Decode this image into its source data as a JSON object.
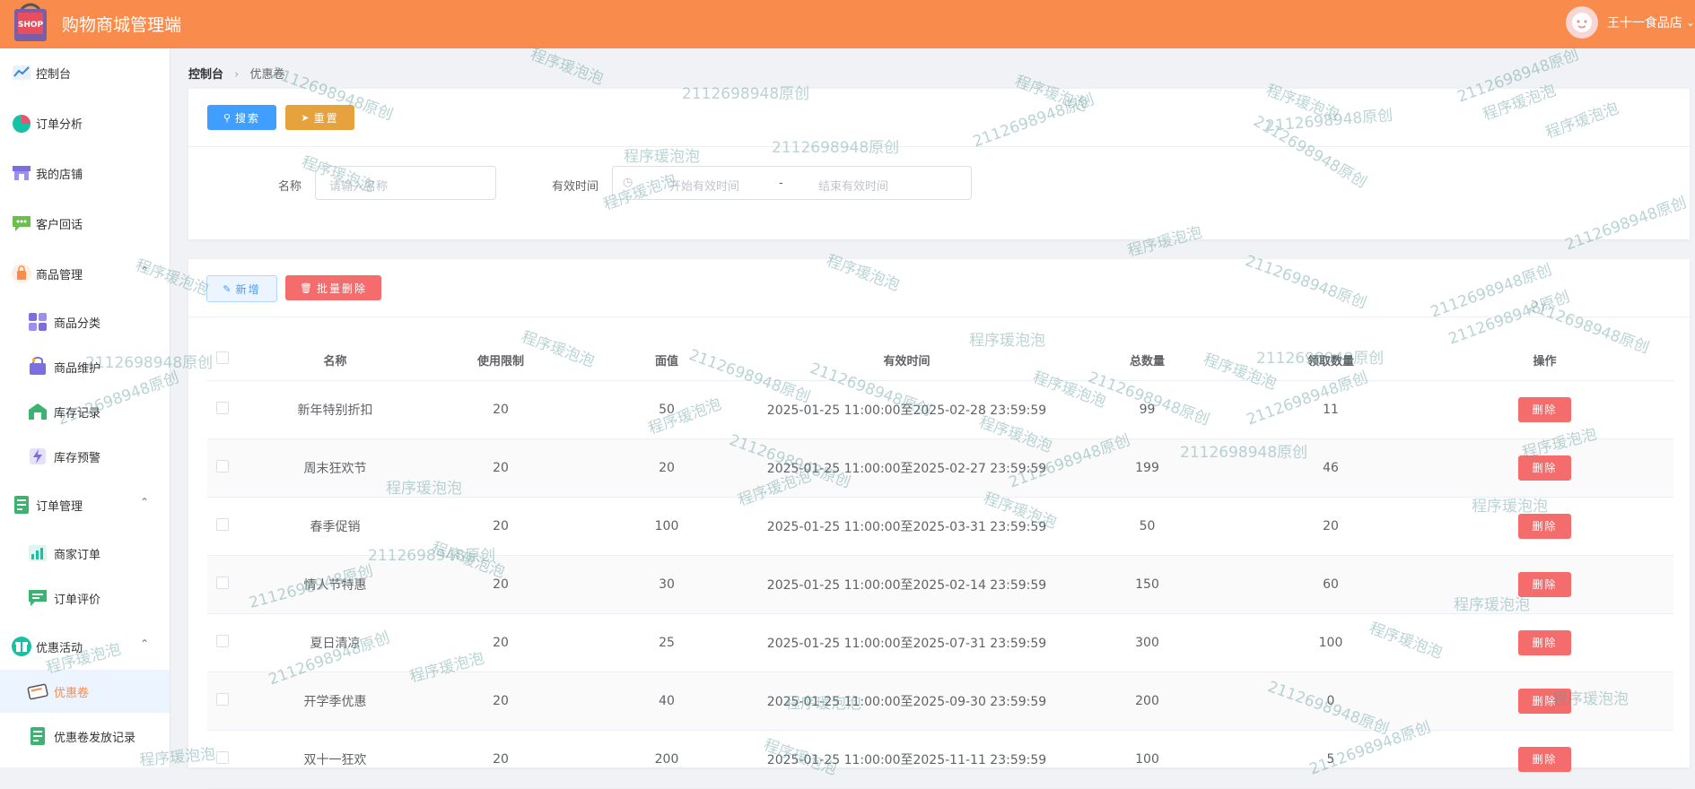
{
  "header": {
    "logo_text": "SHOP",
    "title": "购物商城管理端",
    "user_name": "王十一食品店",
    "colors": {
      "header_bg": "#f98c4d",
      "primary": "#409eff",
      "warning": "#e6a23c",
      "danger": "#f56c6c"
    }
  },
  "sidebar": {
    "items": [
      {
        "label": "控制台",
        "icon": "line-chart-icon"
      },
      {
        "label": "订单分析",
        "icon": "pie-chart-icon"
      },
      {
        "label": "我的店铺",
        "icon": "store-icon"
      },
      {
        "label": "客户回话",
        "icon": "chat-bubble-icon"
      },
      {
        "label": "商品管理",
        "icon": "bag-icon"
      },
      {
        "label": "商品分类",
        "icon": "category-grid-icon"
      },
      {
        "label": "商品维护",
        "icon": "basket-icon"
      },
      {
        "label": "库存记录",
        "icon": "warehouse-icon"
      },
      {
        "label": "库存预警",
        "icon": "lightning-icon"
      },
      {
        "label": "订单管理",
        "icon": "order-list-icon"
      },
      {
        "label": "商家订单",
        "icon": "bar-chart-icon"
      },
      {
        "label": "订单评价",
        "icon": "comment-icon"
      },
      {
        "label": "优惠活动",
        "icon": "gift-icon"
      },
      {
        "label": "优惠卷",
        "icon": "ticket-icon"
      },
      {
        "label": "优惠卷发放记录",
        "icon": "record-list-icon"
      }
    ]
  },
  "breadcrumb": {
    "home": "控制台",
    "current": "优惠卷"
  },
  "search": {
    "search_label": "搜索",
    "reset_label": "重置",
    "name_label": "名称",
    "name_placeholder": "请输入名称",
    "time_label": "有效时间",
    "start_placeholder": "开始有效时间",
    "range_sep": "-",
    "end_placeholder": "结束有效时间"
  },
  "toolbar": {
    "add_label": "新增",
    "batch_delete_label": "批量删除"
  },
  "table": {
    "headers": [
      "名称",
      "使用限制",
      "面值",
      "有效时间",
      "总数量",
      "领取数量",
      "操作"
    ],
    "delete_label": "删除",
    "rows": [
      {
        "name": "新年特别折扣",
        "limit": "20",
        "value": "50",
        "time": "2025-01-25 11:00:00至2025-02-28 23:59:59",
        "total": "99",
        "claimed": "11"
      },
      {
        "name": "周末狂欢节",
        "limit": "20",
        "value": "20",
        "time": "2025-01-25 11:00:00至2025-02-27 23:59:59",
        "total": "199",
        "claimed": "46"
      },
      {
        "name": "春季促销",
        "limit": "20",
        "value": "100",
        "time": "2025-01-25 11:00:00至2025-03-31 23:59:59",
        "total": "50",
        "claimed": "20"
      },
      {
        "name": "情人节特惠",
        "limit": "20",
        "value": "30",
        "time": "2025-01-25 11:00:00至2025-02-14 23:59:59",
        "total": "150",
        "claimed": "60"
      },
      {
        "name": "夏日清凉",
        "limit": "20",
        "value": "25",
        "time": "2025-01-25 11:00:00至2025-07-31 23:59:59",
        "total": "300",
        "claimed": "100"
      },
      {
        "name": "开学季优惠",
        "limit": "20",
        "value": "40",
        "time": "2025-01-25 11:00:00至2025-09-30 23:59:59",
        "total": "200",
        "claimed": "0"
      },
      {
        "name": "双十一狂欢",
        "limit": "20",
        "value": "200",
        "time": "2025-01-25 11:00:00至2025-11-11 23:59:59",
        "total": "100",
        "claimed": "5"
      }
    ]
  },
  "watermarks": {
    "text_a": "程序瑗泡泡",
    "text_b": "2112698948原创"
  }
}
